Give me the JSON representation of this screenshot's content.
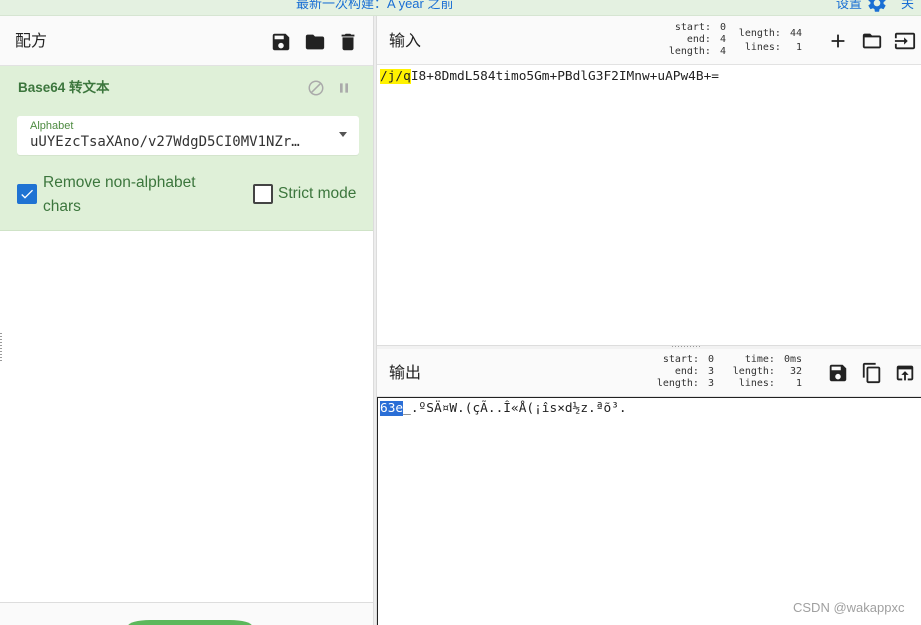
{
  "banner": {
    "build_text": "最新一次构建：A year 之前",
    "settings_label": "设置",
    "settings_icon": "gear-icon",
    "about_label": "关"
  },
  "recipe": {
    "title": "配方",
    "icons": [
      "save-icon",
      "folder-icon",
      "delete-icon"
    ],
    "operation": {
      "name": "Base64 转文本",
      "icons": [
        "disable-icon",
        "pause-icon"
      ],
      "alphabet": {
        "label": "Alphabet",
        "value": "uUYEzcTsaXAno/v27WdgD5CI0MV1NZr…"
      },
      "remove_non_alphabet": {
        "label": "Remove non-alphabet chars",
        "checked": true
      },
      "strict_mode": {
        "label": "Strict mode",
        "checked": false
      }
    }
  },
  "input": {
    "title": "输入",
    "icons": [
      "add-icon",
      "folder-open-icon",
      "input-icon"
    ],
    "stats": {
      "selection": [
        {
          "label": "start:",
          "value": "0"
        },
        {
          "label": "end:",
          "value": "4"
        },
        {
          "label": "length:",
          "value": "4"
        }
      ],
      "totals": [
        {
          "label": "length:",
          "value": "44"
        },
        {
          "label": "lines:",
          "value": "1"
        }
      ]
    },
    "text": {
      "highlighted": "/j/q",
      "rest": "I8+8DmdL584timo5Gm+PBdlG3F2IMnw+uAPw4B+="
    }
  },
  "output": {
    "title": "输出",
    "icons": [
      "save-icon",
      "copy-icon",
      "replace-input-icon"
    ],
    "stats": {
      "selection": [
        {
          "label": "start:",
          "value": "0"
        },
        {
          "label": "end:",
          "value": "3"
        },
        {
          "label": "length:",
          "value": "3"
        }
      ],
      "totals": [
        {
          "label": "time:",
          "value": "0ms"
        },
        {
          "label": "length:",
          "value": "32"
        },
        {
          "label": "lines:",
          "value": "1"
        }
      ]
    },
    "text": {
      "highlighted": "63e",
      "rest": "_.ºSÄ¤W.(çÃ..Î«Å(¡îs×d½z.ªõ³."
    }
  },
  "watermark": "CSDN @wakappxc",
  "colors": {
    "banner_bg": "#e4f1e1",
    "link_blue": "#1a6fd4",
    "operation_bg": "#dff0d8",
    "operation_text": "#3c763d",
    "checkbox_blue": "#1f73d3",
    "input_highlight": "#fff200",
    "output_highlight": "#2a6ed6",
    "bake_green": "#5cb85c"
  }
}
